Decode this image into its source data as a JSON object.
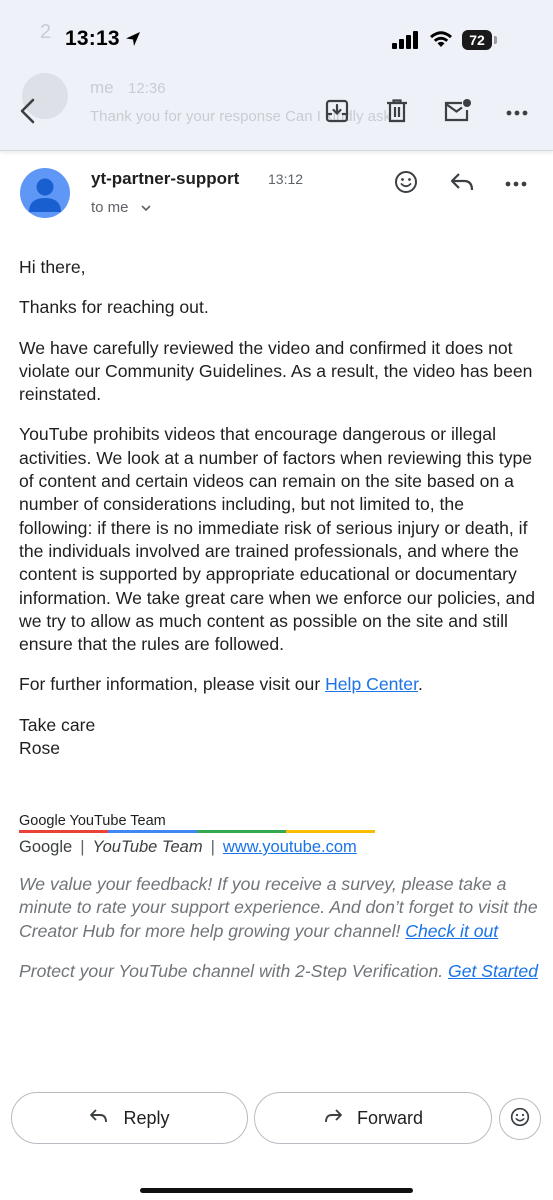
{
  "status_bar": {
    "time": "13:13",
    "battery": "72"
  },
  "background_thread": {
    "count": "2",
    "sender": "me",
    "time": "12:36",
    "preview": "Thank you for your response Can I kindly ask..."
  },
  "message": {
    "sender": "yt-partner-support",
    "time": "13:12",
    "recipient": "to me"
  },
  "body": {
    "greeting": "Hi there,",
    "p1": "Thanks for reaching out.",
    "p2": "We have carefully reviewed the video and confirmed it does not violate our Community Guidelines. As a result, the video has been reinstated.",
    "p3": "YouTube prohibits videos that encourage dangerous or illegal activities. We look at a number of factors when reviewing this type of content and certain videos can remain on the site based on a number of considerations including, but not limited to, the following: if there is no immediate risk of serious injury or death, if the individuals involved are trained professionals, and where the content is supported by appropriate educational or documentary information. We take great care when we enforce our policies, and we try to allow as much content as possible on the site and still ensure that the rules are followed.",
    "p4_prefix": "For further information, please visit our ",
    "p4_link": "Help Center",
    "p4_suffix": ".",
    "closing": "Take care",
    "name": "Rose"
  },
  "signature": {
    "title": "Google YouTube Team",
    "google": "Google",
    "separator": "|",
    "team": "YouTube Team",
    "url": "www.youtube.com",
    "rule_colors": [
      "#ea4335",
      "#4285f4",
      "#34a853",
      "#fbbc05"
    ]
  },
  "footer": {
    "feedback": "We value your feedback! If you receive a survey, please take a minute to rate your support experience. And don’t forget to visit the Creator Hub for more help growing your channel! ",
    "feedback_link": "Check it out",
    "protect": "Protect your YouTube channel with 2-Step Verification. ",
    "protect_link": "Get Started"
  },
  "actions": {
    "reply": "Reply",
    "forward": "Forward"
  },
  "icons": {
    "toolbar": [
      "back-arrow-icon",
      "archive-icon",
      "trash-icon",
      "mark-unread-icon",
      "more-vert-icon"
    ],
    "header": [
      "emoji-icon",
      "reply-icon",
      "more-horiz-icon"
    ]
  }
}
